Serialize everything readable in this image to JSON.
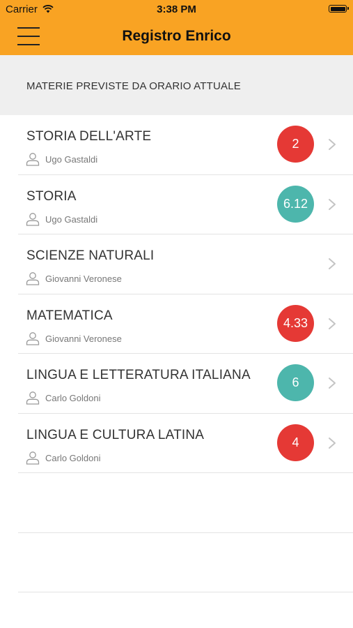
{
  "status_bar": {
    "carrier": "Carrier",
    "time": "3:38 PM"
  },
  "nav": {
    "title": "Registro Enrico",
    "menu_icon": "hamburger-menu-icon"
  },
  "section": {
    "title": "MATERIE PREVISTE DA ORARIO ATTUALE"
  },
  "colors": {
    "nav_bar": "#F9A323",
    "badge_red": "#E53935",
    "badge_teal": "#4DB6AC",
    "section_bg": "#EFEFEF"
  },
  "subjects": [
    {
      "name": "STORIA DELL'ARTE",
      "teacher": "Ugo Gastaldi",
      "grade": "2",
      "grade_color": "red"
    },
    {
      "name": "STORIA",
      "teacher": "Ugo Gastaldi",
      "grade": "6.12",
      "grade_color": "teal"
    },
    {
      "name": "SCIENZE NATURALI",
      "teacher": "Giovanni Veronese",
      "grade": "",
      "grade_color": ""
    },
    {
      "name": "MATEMATICA",
      "teacher": "Giovanni Veronese",
      "grade": "4.33",
      "grade_color": "red"
    },
    {
      "name": "LINGUA E LETTERATURA ITALIANA",
      "teacher": "Carlo Goldoni",
      "grade": "6",
      "grade_color": "teal"
    },
    {
      "name": "LINGUA E CULTURA LATINA",
      "teacher": "Carlo Goldoni",
      "grade": "4",
      "grade_color": "red"
    }
  ]
}
